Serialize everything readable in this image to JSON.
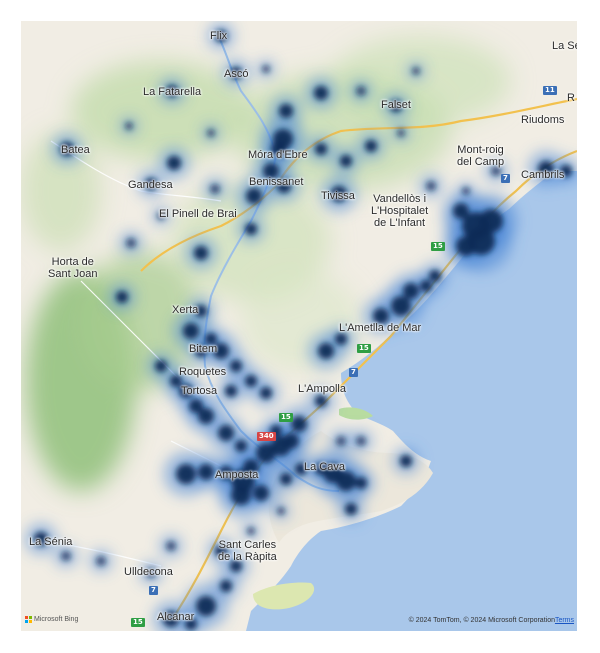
{
  "map": {
    "places": [
      {
        "id": "flix",
        "label": "Flix"
      },
      {
        "id": "la-seu",
        "label": "La Se"
      },
      {
        "id": "asco",
        "label": "Ascó"
      },
      {
        "id": "la-fatarella",
        "label": "La Fatarella"
      },
      {
        "id": "falset",
        "label": "Falset"
      },
      {
        "id": "riudoms",
        "label": "Riudoms"
      },
      {
        "id": "r-edge",
        "label": "R"
      },
      {
        "id": "batea",
        "label": "Batea"
      },
      {
        "id": "mora-debre",
        "label": "Móra d'Ebre"
      },
      {
        "id": "mont-roig",
        "label": "Mont-roig\ndel Camp"
      },
      {
        "id": "gandesa",
        "label": "Gandesa"
      },
      {
        "id": "benissanet",
        "label": "Benissanet"
      },
      {
        "id": "cambrils",
        "label": "Cambrils"
      },
      {
        "id": "tivissa",
        "label": "Tivissa"
      },
      {
        "id": "vandellos",
        "label": "Vandellòs i\nL'Hospitalet\nde L'Infant"
      },
      {
        "id": "el-pinell",
        "label": "El Pinell de Brai"
      },
      {
        "id": "horta",
        "label": "Horta de\nSant Joan"
      },
      {
        "id": "xerta",
        "label": "Xerta"
      },
      {
        "id": "ametlla",
        "label": "L'Ametlla de Mar"
      },
      {
        "id": "bitem",
        "label": "Bitem"
      },
      {
        "id": "roquetes",
        "label": "Roquetes"
      },
      {
        "id": "ampolla",
        "label": "L'Ampolla"
      },
      {
        "id": "tortosa",
        "label": "Tortosa"
      },
      {
        "id": "amposta",
        "label": "Amposta"
      },
      {
        "id": "la-cava",
        "label": "La Cava"
      },
      {
        "id": "la-senia",
        "label": "La Sénia"
      },
      {
        "id": "sant-carles",
        "label": "Sant Carles\nde la Ràpita"
      },
      {
        "id": "ulldecona",
        "label": "Ulldecona"
      },
      {
        "id": "alcanar",
        "label": "Alcanar"
      }
    ],
    "road_shields": [
      {
        "id": "s11",
        "label": "11",
        "color": "blue"
      },
      {
        "id": "s7a",
        "label": "7",
        "color": "blue"
      },
      {
        "id": "s15a",
        "label": "15",
        "color": "green"
      },
      {
        "id": "s15b",
        "label": "15",
        "color": "green"
      },
      {
        "id": "s7b",
        "label": "7",
        "color": "blue"
      },
      {
        "id": "s15c",
        "label": "15",
        "color": "green"
      },
      {
        "id": "s340",
        "label": "340",
        "color": "red"
      },
      {
        "id": "s7c",
        "label": "7",
        "color": "blue"
      },
      {
        "id": "s15d",
        "label": "15",
        "color": "green"
      }
    ],
    "attribution": "© 2024 TomTom, © 2024 Microsoft Corporation",
    "terms_label": "Terms",
    "provider_label": "Microsoft Bing",
    "colors": {
      "sea": "#a9c7ea",
      "land": "#f1ede4",
      "forest": "#9cc48a",
      "heat_core": "#0b2a57",
      "heat_glow": "#4a86d6",
      "highway": "#f2c14e"
    }
  }
}
